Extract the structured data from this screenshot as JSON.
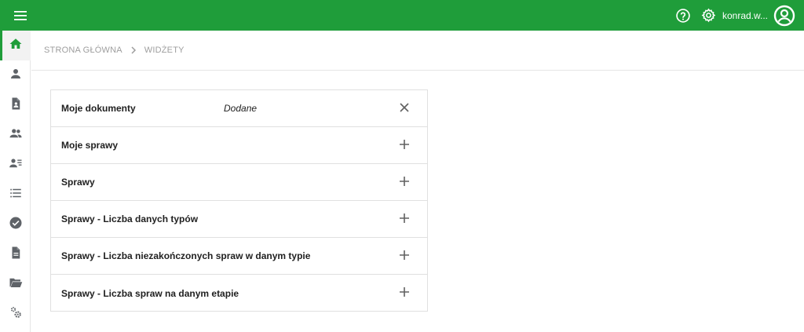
{
  "app": {
    "user_name": "konrad.w...",
    "colors": {
      "brand": "#1f9d3a",
      "icon_gray": "#5f6368"
    }
  },
  "topbar": {
    "menu_icon": "hamburger-menu-icon",
    "help_icon": "help-circle-icon",
    "settings_icon": "gear-icon",
    "avatar_icon": "account-circle-icon"
  },
  "sidebar": {
    "items": [
      {
        "icon": "home-icon",
        "active": true
      },
      {
        "icon": "person-icon",
        "active": false
      },
      {
        "icon": "contact-document-icon",
        "active": false
      },
      {
        "icon": "people-icon",
        "active": false
      },
      {
        "icon": "person-list-icon",
        "active": false
      },
      {
        "icon": "list-icon",
        "active": false
      },
      {
        "icon": "check-circle-icon",
        "active": false
      },
      {
        "icon": "document-icon",
        "active": false
      },
      {
        "icon": "folder-open-icon",
        "active": false
      },
      {
        "icon": "settings-cogs-icon",
        "active": false
      }
    ]
  },
  "breadcrumb": {
    "items": [
      "STRONA GŁÓWNA",
      "WIDŻETY"
    ]
  },
  "widgets": [
    {
      "title": "Moje dokumenty",
      "status": "Dodane",
      "action": "remove"
    },
    {
      "title": "Moje sprawy",
      "status": "",
      "action": "add"
    },
    {
      "title": "Sprawy",
      "status": "",
      "action": "add"
    },
    {
      "title": "Sprawy - Liczba danych typów",
      "status": "",
      "action": "add"
    },
    {
      "title": "Sprawy - Liczba niezakończonych spraw w danym typie",
      "status": "",
      "action": "add"
    },
    {
      "title": "Sprawy - Liczba spraw na danym etapie",
      "status": "",
      "action": "add"
    }
  ]
}
